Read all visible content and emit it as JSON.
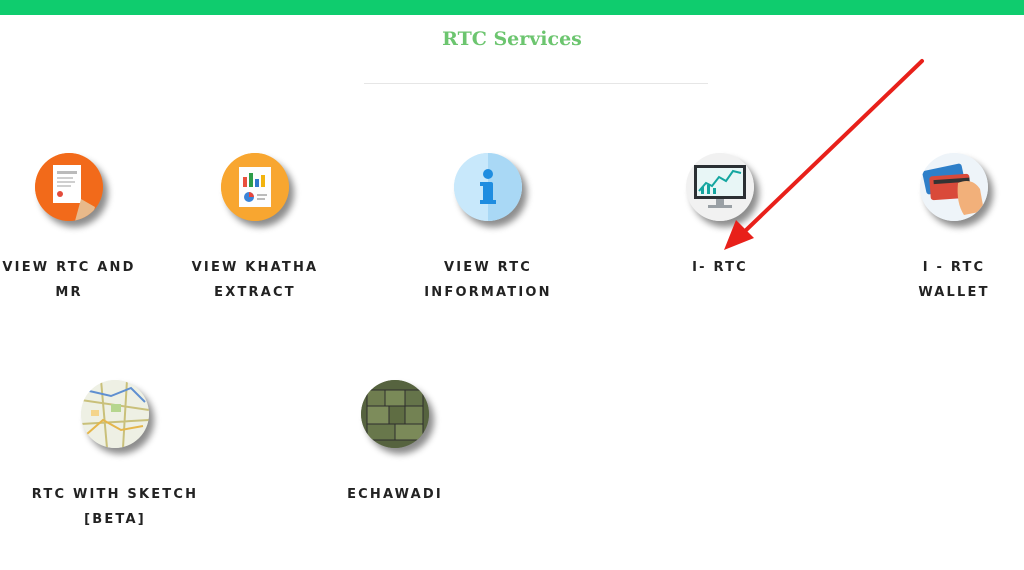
{
  "header": {
    "title": "RTC Services"
  },
  "services_row1": [
    {
      "label": "VIEW RTC AND MR",
      "icon": "document-icon"
    },
    {
      "label": "VIEW KHATHA EXTRACT",
      "icon": "report-chart-icon"
    },
    {
      "label": "VIEW RTC INFORMATION",
      "icon": "info-icon"
    },
    {
      "label": "I- RTC",
      "icon": "monitor-chart-icon"
    },
    {
      "label": "I - RTC WALLET",
      "icon": "wallet-cards-icon"
    }
  ],
  "services_row2": [
    {
      "label": "RTC WITH SKETCH [BETA]",
      "icon": "map-sketch-icon"
    },
    {
      "label": "ECHAWADI",
      "icon": "land-map-icon"
    }
  ],
  "colors": {
    "topbar": "#0fcc6e",
    "title": "#6cc56f",
    "arrow": "#e8201a"
  }
}
